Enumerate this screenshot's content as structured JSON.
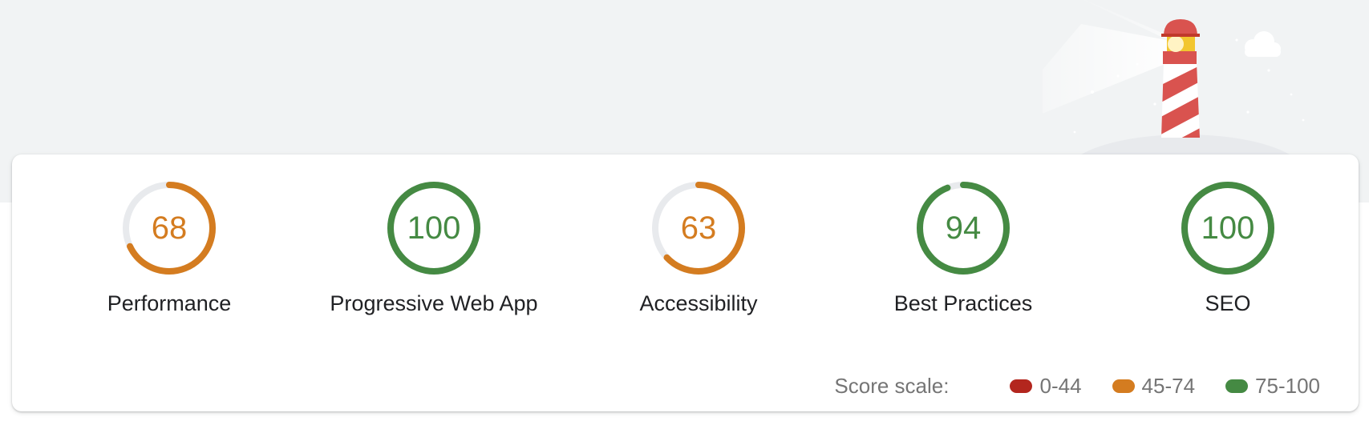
{
  "colors": {
    "fail": "#b3261e",
    "average": "#d47c20",
    "pass": "#458a43",
    "track": "#e8eaed",
    "band": "#f1f3f4"
  },
  "categories": [
    {
      "title": "Performance",
      "score": 68,
      "rating": "average"
    },
    {
      "title": "Progressive Web App",
      "score": 100,
      "rating": "pass"
    },
    {
      "title": "Accessibility",
      "score": 63,
      "rating": "average"
    },
    {
      "title": "Best Practices",
      "score": 94,
      "rating": "pass"
    },
    {
      "title": "SEO",
      "score": 100,
      "rating": "pass"
    }
  ],
  "score_scale": {
    "label": "Score scale:",
    "ranges": [
      {
        "label": "0-44",
        "rating": "fail"
      },
      {
        "label": "45-74",
        "rating": "average"
      },
      {
        "label": "75-100",
        "rating": "pass"
      }
    ]
  },
  "icons": {
    "header_illustration": "lighthouse-icon",
    "cloud": "cloud-icon"
  }
}
